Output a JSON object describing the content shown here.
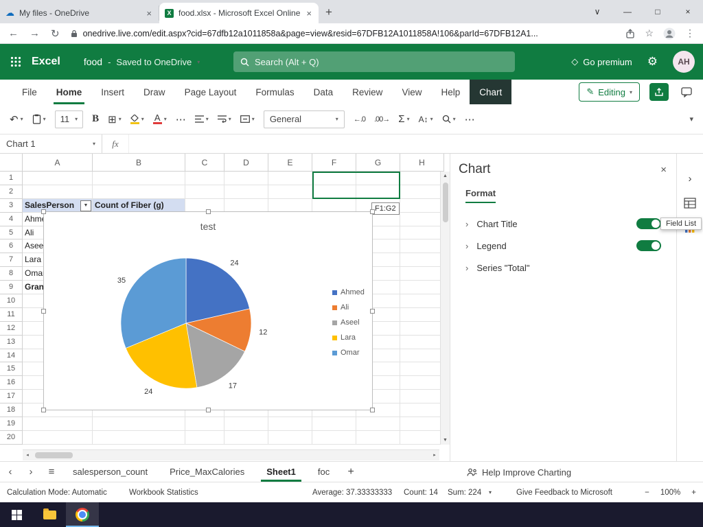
{
  "window": {
    "tabs": [
      {
        "title": "My files - OneDrive"
      },
      {
        "title": "food.xlsx - Microsoft Excel Online"
      }
    ],
    "url": "onedrive.live.com/edit.aspx?cid=67dfb12a1011858a&page=view&resid=67DFB12A1011858A!106&parId=67DFB12A1...",
    "controls": {
      "tabs_menu": "∨",
      "minimize": "—",
      "maximize": "□",
      "close": "×",
      "tab_close": "×",
      "new_tab": "+"
    }
  },
  "icons": {
    "back": "←",
    "forward": "→",
    "refresh": "↻",
    "star": "☆",
    "more_vertical": "⋮",
    "excel_favicon": "X",
    "onedrive_cloud": "☁",
    "premium_diamond": "◇",
    "gear": "⚙",
    "pencil": "✎",
    "undo": "↶",
    "borders": "⊞",
    "bold": "B",
    "font_color_letter": "A",
    "ellipsis": "⋯",
    "sigma": "Σ",
    "sort": "A↕",
    "caret_down": "▾",
    "increase_decimal": "←.0",
    "decrease_decimal": ".00→",
    "scroll_up": "▲",
    "scroll_down": "▼",
    "scroll_left": "◂",
    "scroll_right": "▸",
    "sheet_prev": "‹",
    "sheet_next": "›",
    "sheet_menu": "≡",
    "add_sheet": "+",
    "pane_close": "×",
    "section_chevron": "›",
    "rail_expand": "›",
    "filter": "▼",
    "zoom_out": "−",
    "zoom_in": "+",
    "stats_caret": "▾"
  },
  "header": {
    "app_name": "Excel",
    "file_name": "food",
    "separator": "-",
    "saved_status": "Saved to OneDrive",
    "search_placeholder": "Search (Alt + Q)",
    "go_premium": "Go premium",
    "avatar_initials": "AH"
  },
  "ribbon": {
    "tabs": [
      {
        "label": "File"
      },
      {
        "label": "Home",
        "active": true
      },
      {
        "label": "Insert"
      },
      {
        "label": "Draw"
      },
      {
        "label": "Page Layout"
      },
      {
        "label": "Formulas"
      },
      {
        "label": "Data"
      },
      {
        "label": "Review"
      },
      {
        "label": "View"
      },
      {
        "label": "Help"
      },
      {
        "label": "Chart",
        "contextual": true
      }
    ],
    "editing_label": "Editing",
    "font_size": "11",
    "number_format": "General"
  },
  "formula_bar": {
    "name_box": "Chart 1",
    "fx_label": "fx",
    "value": ""
  },
  "grid": {
    "col_headers": [
      "A",
      "B",
      "C",
      "D",
      "E",
      "F",
      "G",
      "H"
    ],
    "row_count": 20,
    "cells": [
      {
        "ref": "A3",
        "text": "SalesPerson",
        "style": "pivot-header",
        "filter": true
      },
      {
        "ref": "B3",
        "text": "Count of Fiber (g)",
        "style": "pivot-header"
      },
      {
        "ref": "A4",
        "text": "Ahmed"
      },
      {
        "ref": "A5",
        "text": "Ali"
      },
      {
        "ref": "A6",
        "text": "Aseel"
      },
      {
        "ref": "A7",
        "text": "Lara"
      },
      {
        "ref": "A8",
        "text": "Omar"
      },
      {
        "ref": "A9",
        "text": "Grand Total",
        "style": "bold"
      }
    ],
    "selection_label": "F1:G2"
  },
  "chart_data": {
    "type": "pie",
    "title": "test",
    "categories": [
      "Ahmed",
      "Ali",
      "Aseel",
      "Lara",
      "Omar"
    ],
    "values": [
      24,
      12,
      17,
      24,
      35
    ],
    "colors": [
      "#4472c4",
      "#ed7d31",
      "#a5a5a5",
      "#ffc000",
      "#5b9bd5"
    ],
    "legend_position": "right",
    "data_labels": true
  },
  "chart_pane": {
    "title": "Chart",
    "tab_label": "Format",
    "sections": [
      {
        "label": "Chart Title",
        "toggle": "on"
      },
      {
        "label": "Legend",
        "toggle": "on"
      },
      {
        "label": "Series \"Total\"",
        "toggle": "none"
      }
    ],
    "tooltip": "Field List"
  },
  "sheet_bar": {
    "tabs": [
      {
        "label": "salesperson_count"
      },
      {
        "label": "Price_MaxCalories"
      },
      {
        "label": "Sheet1",
        "active": true
      },
      {
        "label": "foc"
      }
    ],
    "help_link": "Help Improve Charting"
  },
  "status_bar": {
    "calc_mode": "Calculation Mode: Automatic",
    "workbook_stats": "Workbook Statistics",
    "average": "Average: 37.33333333",
    "count": "Count: 14",
    "sum": "Sum: 224",
    "feedback": "Give Feedback to Microsoft",
    "zoom": "100%"
  },
  "colors": {
    "excel_green": "#107c41",
    "pivot_header_bg": "#d3ddf1",
    "contextual_tab_bg": "#253733"
  }
}
